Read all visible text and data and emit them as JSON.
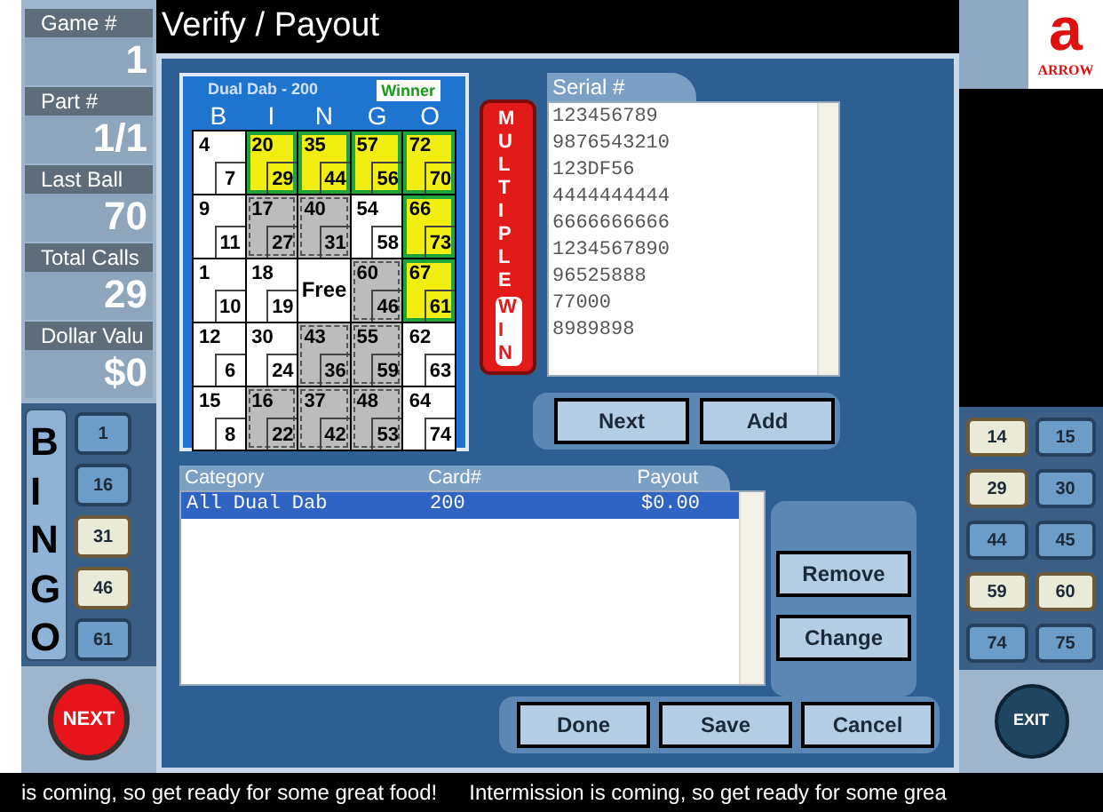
{
  "stats": [
    {
      "label": "Game #",
      "value": "1"
    },
    {
      "label": "Part #",
      "value": "1/1"
    },
    {
      "label": "Last Ball",
      "value": "70"
    },
    {
      "label": "Total Calls",
      "value": "29"
    },
    {
      "label": "Dollar Valu",
      "value": "$0"
    }
  ],
  "board_letters": "BINGO",
  "left_balls": [
    {
      "label": "1",
      "lit": false
    },
    {
      "label": "16",
      "lit": false
    },
    {
      "label": "31",
      "lit": true
    },
    {
      "label": "46",
      "lit": true
    },
    {
      "label": "61",
      "lit": false
    }
  ],
  "right_balls": [
    {
      "label": "14",
      "lit": true
    },
    {
      "label": "15",
      "lit": false
    },
    {
      "label": "29",
      "lit": true
    },
    {
      "label": "30",
      "lit": false
    },
    {
      "label": "44",
      "lit": false
    },
    {
      "label": "45",
      "lit": false
    },
    {
      "label": "59",
      "lit": true
    },
    {
      "label": "60",
      "lit": true
    },
    {
      "label": "74",
      "lit": false
    },
    {
      "label": "75",
      "lit": false
    }
  ],
  "next_button": "NEXT",
  "exit_button": "EXIT",
  "logo": {
    "mark": "a",
    "text": "ARROW"
  },
  "dialog": {
    "title": "Verify / Payout",
    "card": {
      "name": "Dual Dab - 200",
      "badge": "Winner",
      "letters": [
        "B",
        "I",
        "N",
        "G",
        "O"
      ],
      "rows": [
        [
          {
            "kind": "open",
            "a": "4",
            "b": "7"
          },
          {
            "kind": "winner",
            "a": "20",
            "b": "29"
          },
          {
            "kind": "winner",
            "a": "35",
            "b": "44"
          },
          {
            "kind": "winner",
            "a": "57",
            "b": "56"
          },
          {
            "kind": "winner",
            "a": "72",
            "b": "70"
          }
        ],
        [
          {
            "kind": "open",
            "a": "9",
            "b": "11"
          },
          {
            "kind": "called",
            "a": "17",
            "b": "27"
          },
          {
            "kind": "called",
            "a": "40",
            "b": "31"
          },
          {
            "kind": "open",
            "a": "54",
            "b": "58"
          },
          {
            "kind": "winner",
            "a": "66",
            "b": "73"
          }
        ],
        [
          {
            "kind": "open",
            "a": "1",
            "b": "10"
          },
          {
            "kind": "open",
            "a": "18",
            "b": "19"
          },
          {
            "kind": "free",
            "a": "Free"
          },
          {
            "kind": "called",
            "a": "60",
            "b": "46"
          },
          {
            "kind": "winner",
            "a": "67",
            "b": "61"
          }
        ],
        [
          {
            "kind": "open",
            "a": "12",
            "b": "6"
          },
          {
            "kind": "open",
            "a": "30",
            "b": "24"
          },
          {
            "kind": "called",
            "a": "43",
            "b": "36"
          },
          {
            "kind": "called",
            "a": "55",
            "b": "59"
          },
          {
            "kind": "open",
            "a": "62",
            "b": "63"
          }
        ],
        [
          {
            "kind": "open",
            "a": "15",
            "b": "8"
          },
          {
            "kind": "called",
            "a": "16",
            "b": "22"
          },
          {
            "kind": "called",
            "a": "37",
            "b": "42"
          },
          {
            "kind": "called",
            "a": "48",
            "b": "53"
          },
          {
            "kind": "open",
            "a": "64",
            "b": "74"
          }
        ]
      ]
    },
    "multiple_win": {
      "top": "MULTIPLE",
      "bottom": "WIN"
    },
    "serial": {
      "label": "Serial #",
      "items": [
        "123456789",
        "9876543210",
        "123DF56",
        "4444444444",
        "6666666666",
        "1234567890",
        "96525888",
        "77000",
        "8989898"
      ]
    },
    "serial_buttons": [
      "Next",
      "Add"
    ],
    "table": {
      "columns": [
        "Category",
        "Card#",
        "Payout"
      ],
      "rows": [
        {
          "cells": [
            "All Dual Dab",
            "200",
            "$0.00"
          ],
          "selected": true
        }
      ]
    },
    "side_buttons": [
      "Remove",
      "Change"
    ],
    "bottom_buttons": [
      "Done",
      "Save",
      "Cancel"
    ]
  },
  "ticker": [
    "is coming, so get ready for some great food!",
    "Intermission is coming, so get ready for some grea"
  ]
}
